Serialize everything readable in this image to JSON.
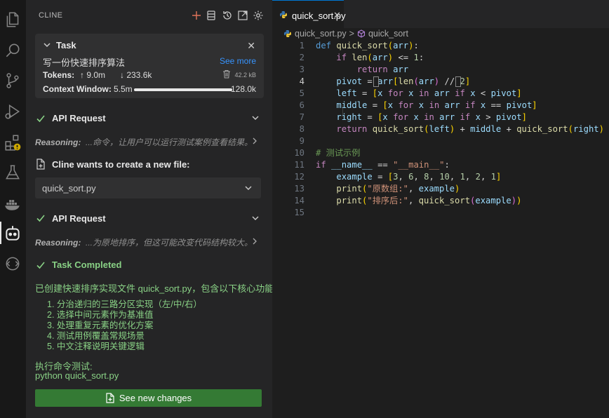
{
  "activity_bar": {
    "icons": [
      "explorer-icon",
      "search-icon",
      "source-control-icon",
      "run-debug-icon",
      "extensions-icon",
      "testing-icon",
      "docker-icon",
      "cline-icon",
      "remote-icon"
    ]
  },
  "panel": {
    "title": "CLINE",
    "header_icons": [
      "plus-icon",
      "history-list-icon",
      "history-icon",
      "popout-icon",
      "settings-icon"
    ]
  },
  "task": {
    "title": "Task",
    "description": "写一份快速排序算法",
    "see_more": "See more",
    "tokens_label": "Tokens:",
    "tokens_up": "↑ 9.0m",
    "tokens_down": "↓ 233.6k",
    "size": "42.2 kB",
    "context_label": "Context Window:",
    "context_used": "5.5m",
    "context_total": "128.0k",
    "context_fraction": 1.0
  },
  "messages": {
    "api_request_1": "API Request",
    "reasoning_label_1": "Reasoning:",
    "reasoning_text_1": "...命令，让用户可以运行测试案例查看结果。",
    "file_msg": "Cline wants to create a new file:",
    "file_name": "quick_sort.py",
    "api_request_2": "API Request",
    "reasoning_label_2": "Reasoning:",
    "reasoning_text_2": "...为原地排序，但这可能改变代码结构较大。",
    "completed": "Task Completed",
    "summary": "已创建快速排序实现文件 quick_sort.py，包含以下核心功能：",
    "items": [
      "1. 分治递归的三路分区实现（左/中/右）",
      "2. 选择中间元素作为基准值",
      "3. 处理重复元素的优化方案",
      "4. 测试用例覆盖常规场景",
      "5. 中文注释说明关键逻辑"
    ],
    "run_label": "执行命令测试:",
    "run_cmd": "python quick_sort.py",
    "see_changes": "See new changes"
  },
  "editor": {
    "tab_label": "quick_sort.py",
    "breadcrumb_file": "quick_sort.py",
    "breadcrumb_symbol": "quick_sort",
    "line_numbers": [
      "1",
      "2",
      "3",
      "4",
      "5",
      "6",
      "7",
      "8",
      "9",
      "10",
      "11",
      "12",
      "13",
      "14",
      "15"
    ],
    "current_line": 4,
    "code": {
      "l1_def": "def",
      "l1_fn": "quick_sort",
      "l1_arg": "arr",
      "l2_if": "if",
      "l2_len": "len",
      "l2_arg": "arr",
      "l2_op": ") <= ",
      "l2_num": "1",
      "l3_ret": "return",
      "l3_arg": "arr",
      "l4_pivot": "pivot",
      "l4_arr": "arr",
      "l4_len": "len",
      "l4_arg": "arr",
      "l4_num": "2",
      "l5": "left",
      "l6": "middle",
      "l7": "right",
      "l8_ret": "return",
      "l8_fn1": "quick_sort",
      "l8_left": "left",
      "l8_mid": "middle",
      "l8_fn2": "quick_sort",
      "l8_right": "right",
      "l10_comment": "# 测试示例",
      "l11_if": "if",
      "l11_name": "__name__",
      "l11_str": "\"__main__\"",
      "l12_var": "example",
      "l12_nums": [
        "3",
        "6",
        "8",
        "10",
        "1",
        "2",
        "1"
      ],
      "l13_print": "print",
      "l13_str": "\"原数组:\"",
      "l13_var": "example",
      "l14_print": "print",
      "l14_str": "\"排序后:\"",
      "l14_fn": "quick_sort",
      "l14_var": "example"
    }
  },
  "colors": {
    "accent_green": "#89d185",
    "button_green": "#347a34",
    "link_blue": "#3794ff",
    "tab_border": "#0078d4"
  }
}
